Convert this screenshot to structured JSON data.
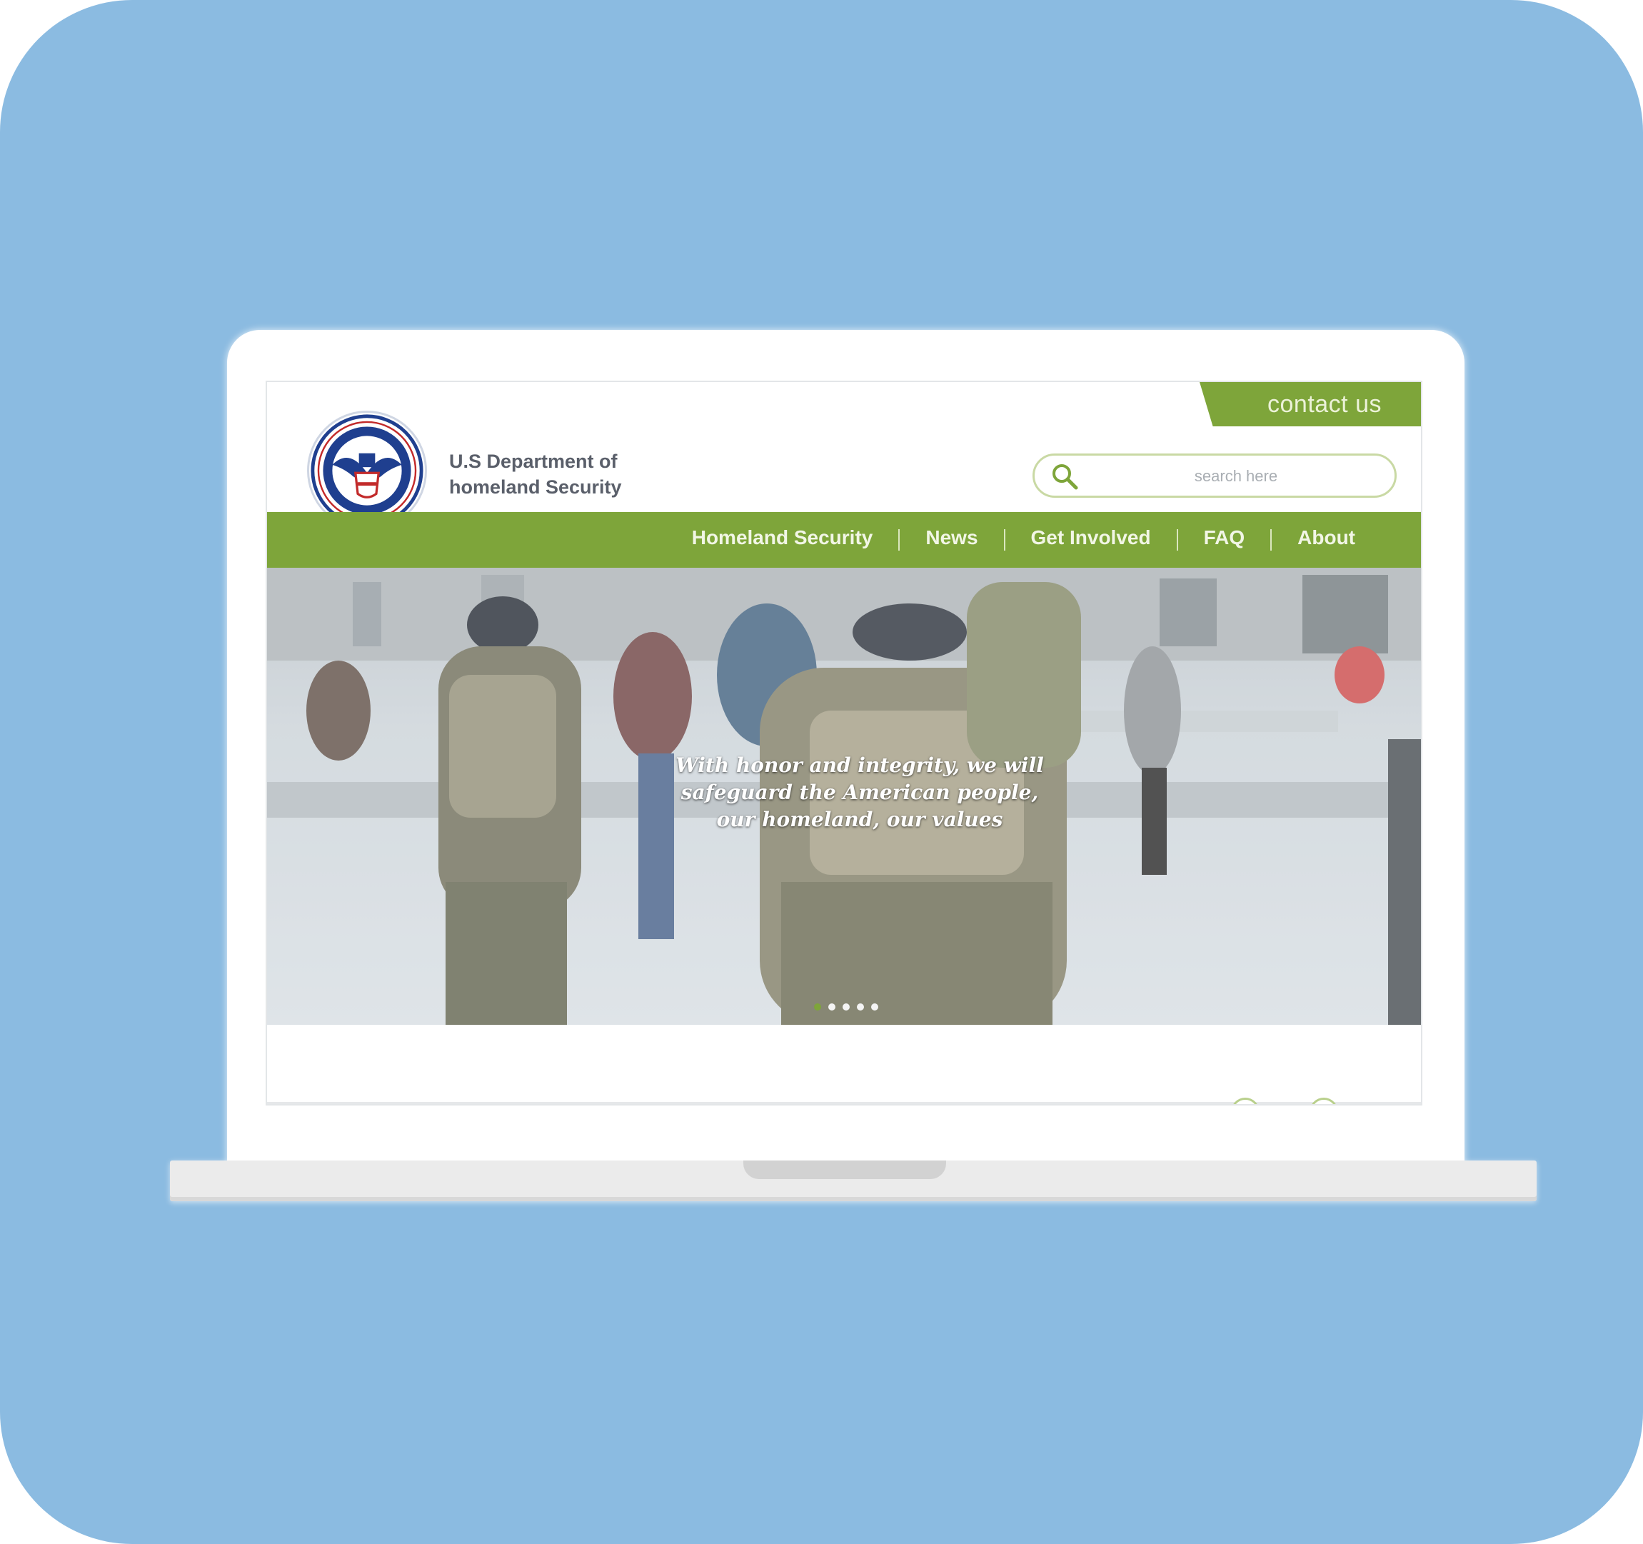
{
  "site": {
    "org_name_line1": "U.S Department of",
    "org_name_line2": "homeland Security",
    "contact_label": "contact us",
    "search_placeholder": "search here"
  },
  "nav": {
    "items": [
      "Homeland Security",
      "News",
      "Get Involved",
      "FAQ",
      "About"
    ]
  },
  "hero": {
    "caption_line1": "With honor and integrity, we will",
    "caption_line2": "safeguard the American people,",
    "caption_line3": "our homeland, our values",
    "slide_count": 5,
    "active_slide": 1
  },
  "colors": {
    "background": "#8bbbe1",
    "accent_green": "#7ea53a",
    "seal_blue": "#1f3f8f"
  },
  "icons": {
    "search": "search-icon",
    "seal": "dhs-seal-icon"
  }
}
